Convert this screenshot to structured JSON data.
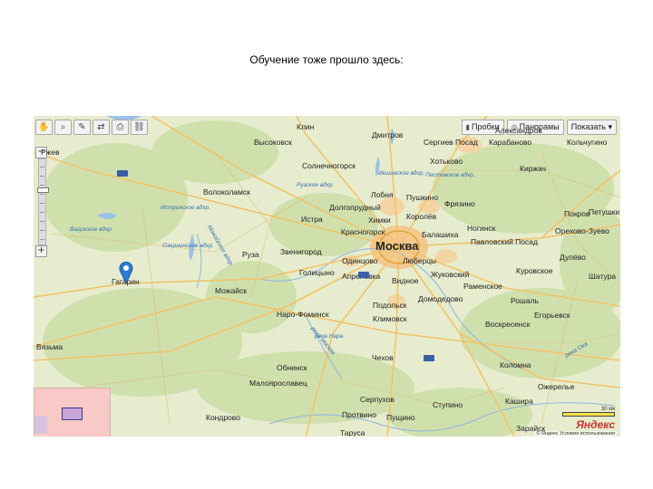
{
  "caption": "Обучение тоже прошло здесь:",
  "toolbar": {
    "tools": [
      "hand-icon",
      "zoom-area-icon",
      "ruler-icon",
      "route-icon",
      "print-icon",
      "link-icon"
    ],
    "buttons": [
      {
        "label": "Пробки",
        "icon": "traffic-icon"
      },
      {
        "label": "Панорамы",
        "icon": "panorama-icon"
      },
      {
        "label": "Показать ▾",
        "icon": ""
      }
    ]
  },
  "zoom": {
    "plus": "+",
    "minus": "−",
    "level_fraction": 0.35
  },
  "map": {
    "big_city": "Москва",
    "cities": [
      "Клин",
      "Дмитров",
      "Сергиев Посад",
      "Александров",
      "Высоковск",
      "Солнечногорск",
      "Хотьково",
      "Кольчугино",
      "Карабаново",
      "Киржач",
      "Ржев",
      "Волоколамск",
      "Лобня",
      "Пушкино",
      "Фрязино",
      "Долгопрудный",
      "Химки",
      "Королёв",
      "Истра",
      "Красногорск",
      "Балашиха",
      "Ногинск",
      "Покров",
      "Петушки",
      "Руза",
      "Звенигород",
      "Одинцово",
      "Павловский Посад",
      "Орехово-Зуево",
      "Люберцы",
      "Жуковский",
      "Куровское",
      "Дулёво",
      "Голицыно",
      "Гагарин",
      "Можайск",
      "Видное",
      "Апрелевка",
      "Раменское",
      "Шатура",
      "Наро-Фоминск",
      "Подольск",
      "Домодедово",
      "Егорьевск",
      "Климовск",
      "Воскресенск",
      "Вязьма",
      "Обнинск",
      "Чехов",
      "Коломна",
      "Малоярославец",
      "Серпухов",
      "Ступино",
      "Кондрово",
      "Пущино",
      "Зарайск",
      "Таруса",
      "Протвино",
      "Рошаль",
      "Ожерелье",
      "Кашира"
    ],
    "water_labels": [
      "Вазузское вдхр.",
      "Истринское вдхр.",
      "Икшинское вдхр.",
      "Рузское вдхр.",
      "Можайское вдхр.",
      "Озернинское вдхр.",
      "Пестовское вдхр.",
      "река Москва",
      "река Ока",
      "река Нара"
    ],
    "pin": "location-pin-icon",
    "scale": "30 км",
    "logo": "Яндекс",
    "copyright": "© Яндекс   Условия использования"
  },
  "colors": {
    "land": "#e6eccd",
    "forest": "#cfe0ad",
    "road": "#f2c46a",
    "city_area": "#f3c98f",
    "water": "#9cc1e6",
    "pin": "#2e7bd2"
  }
}
